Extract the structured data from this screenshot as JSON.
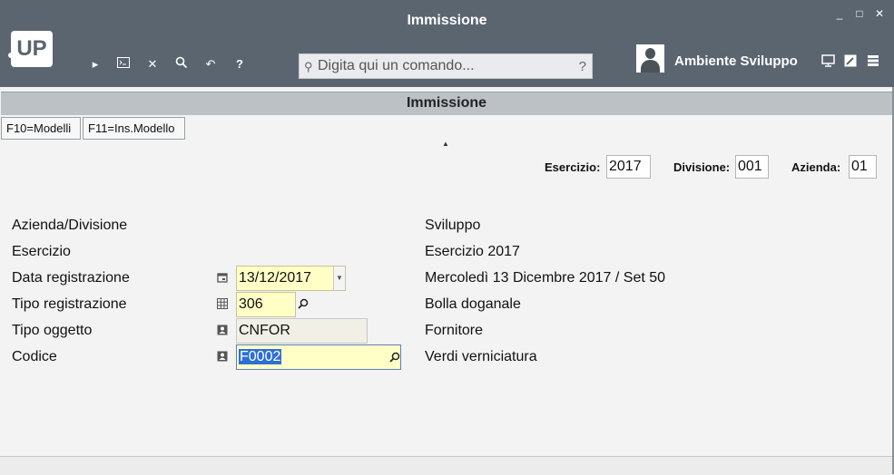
{
  "window": {
    "title": "Immissione",
    "min": "_",
    "max": "□",
    "close": "✕"
  },
  "logo": {
    "text": "UP"
  },
  "toolbar": {
    "icons": [
      "play-icon",
      "terminal-icon",
      "close-icon",
      "search-icon",
      "undo-icon",
      "help-icon"
    ]
  },
  "command": {
    "placeholder": "Digita qui un comando...",
    "help": "?"
  },
  "user": {
    "environment": "Ambiente Sviluppo"
  },
  "subtitle": "Immissione",
  "buttons": {
    "f10": "F10=Modelli",
    "f11": "F11=Ins.Modello"
  },
  "header": {
    "esercizio_label": "Esercizio:",
    "esercizio_value": "2017",
    "divisione_label": "Divisione:",
    "divisione_value": "001",
    "azienda_label": "Azienda:",
    "azienda_value": "01"
  },
  "form": {
    "azienda_divisione": {
      "label": "Azienda/Divisione",
      "desc": "Sviluppo"
    },
    "esercizio": {
      "label": "Esercizio",
      "desc": "Esercizio 2017"
    },
    "data_registrazione": {
      "label": "Data registrazione",
      "value": "13/12/2017",
      "desc": "Mercoledì 13 Dicembre 2017 / Set 50"
    },
    "tipo_registrazione": {
      "label": "Tipo registrazione",
      "value": "306",
      "desc": "Bolla doganale"
    },
    "tipo_oggetto": {
      "label": "Tipo oggetto",
      "value": "CNFOR",
      "desc": "Fornitore"
    },
    "codice": {
      "label": "Codice",
      "value": "F0002",
      "desc": "Verdi verniciatura"
    }
  },
  "colors": {
    "titlebar": "#5b6570",
    "subtitle_bar": "#bcc1c6",
    "field_yellow": "#ffffc6",
    "selection": "#2d6fd6"
  }
}
